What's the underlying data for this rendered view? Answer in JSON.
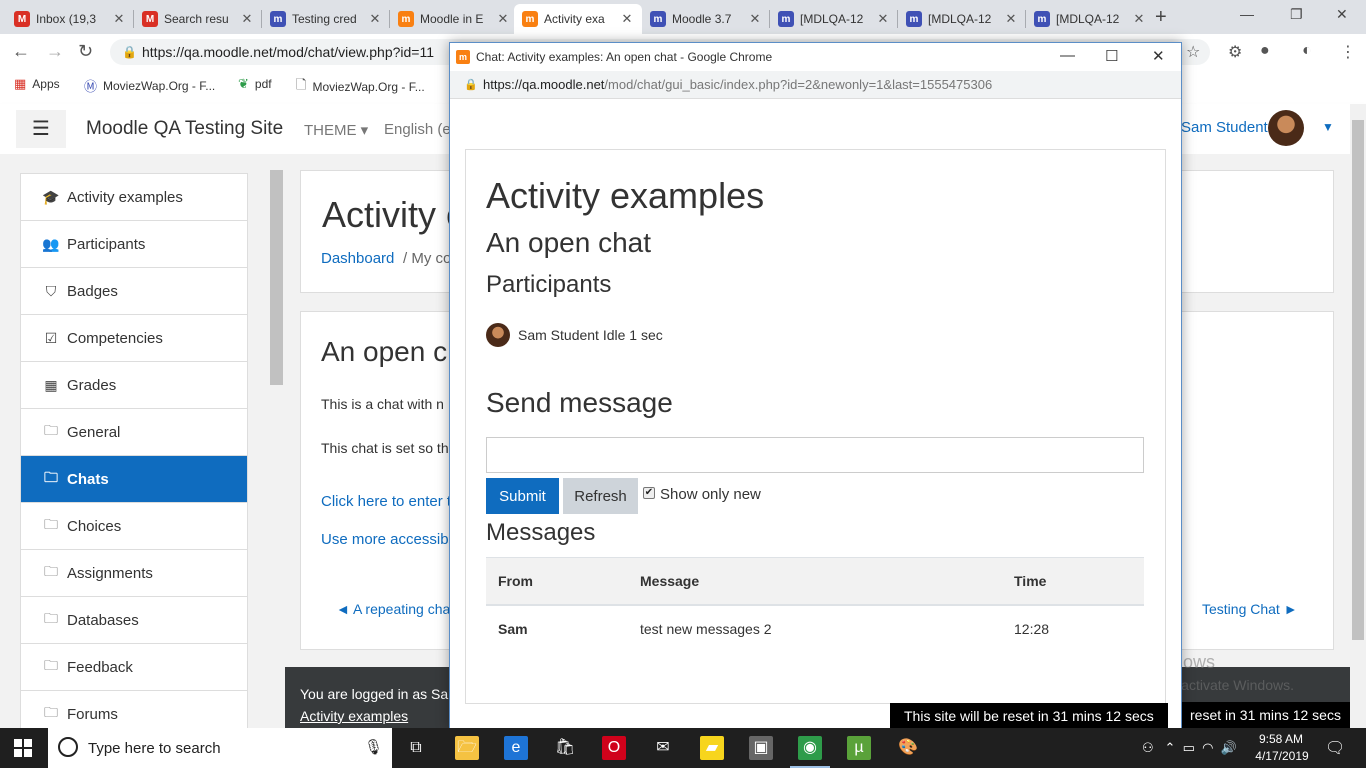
{
  "browser": {
    "tabs": [
      {
        "title": "Inbox (19,3",
        "icon": "gmail-icon",
        "color": "#d93025",
        "glyph": "M"
      },
      {
        "title": "Search resu",
        "icon": "gmail-icon",
        "color": "#d93025",
        "glyph": "M"
      },
      {
        "title": "Testing cred",
        "icon": "moodle-tracker-icon",
        "color": "#3f51b5",
        "glyph": "m"
      },
      {
        "title": "Moodle in E",
        "icon": "moodle-icon",
        "color": "#f98012",
        "glyph": "m"
      },
      {
        "title": "Activity exa",
        "icon": "moodle-icon",
        "color": "#f98012",
        "glyph": "m",
        "active": true
      },
      {
        "title": "Moodle 3.7",
        "icon": "moodle-tracker-icon",
        "color": "#3f51b5",
        "glyph": "m"
      },
      {
        "title": "[MDLQA-12",
        "icon": "moodle-tracker-icon",
        "color": "#3f51b5",
        "glyph": "m"
      },
      {
        "title": "[MDLQA-12",
        "icon": "moodle-tracker-icon",
        "color": "#3f51b5",
        "glyph": "m"
      },
      {
        "title": "[MDLQA-12",
        "icon": "moodle-tracker-icon",
        "color": "#3f51b5",
        "glyph": "m"
      }
    ],
    "url": "https://qa.moodle.net/mod/chat/view.php?id=11",
    "bookmarks": [
      {
        "label": "Apps",
        "icon": "apps-grid-icon"
      },
      {
        "label": "MoviezWap.Org - F...",
        "icon": "moviezwap-icon"
      },
      {
        "label": "pdf",
        "icon": "pdf-icon"
      },
      {
        "label": "MoviezWap.Org - F...",
        "icon": "page-icon"
      }
    ]
  },
  "moodle": {
    "site_name": "Moodle QA Testing Site",
    "theme_menu": "THEME",
    "language_menu": "English (e",
    "user_name": "Sam Student",
    "drawer": [
      {
        "label": "Activity examples",
        "icon": "graduation-cap-icon",
        "glyph": "🎓"
      },
      {
        "label": "Participants",
        "icon": "users-icon",
        "glyph": "👥"
      },
      {
        "label": "Badges",
        "icon": "shield-icon",
        "glyph": "⛉"
      },
      {
        "label": "Competencies",
        "icon": "check-square-icon",
        "glyph": "☑"
      },
      {
        "label": "Grades",
        "icon": "table-icon",
        "glyph": "▦"
      },
      {
        "label": "General",
        "icon": "folder-icon",
        "glyph": "🗀"
      },
      {
        "label": "Chats",
        "icon": "folder-icon",
        "glyph": "🗀",
        "active": true
      },
      {
        "label": "Choices",
        "icon": "folder-icon",
        "glyph": "🗀"
      },
      {
        "label": "Assignments",
        "icon": "folder-icon",
        "glyph": "🗀"
      },
      {
        "label": "Databases",
        "icon": "folder-icon",
        "glyph": "🗀"
      },
      {
        "label": "Feedback",
        "icon": "folder-icon",
        "glyph": "🗀"
      },
      {
        "label": "Forums",
        "icon": "folder-icon",
        "glyph": "🗀"
      }
    ],
    "page_heading": "Activity e",
    "breadcrumb_dashboard": "Dashboard",
    "breadcrumb_next": "/   My co",
    "chat_heading": "An open c",
    "intro_line1": "This is a chat with n",
    "intro_line2": "This chat is set so th",
    "enter_link": "Click here to enter t",
    "accessible_link": "Use more accessible",
    "prev_activity": "◄ A repeating cha",
    "next_activity": "Testing Chat ►",
    "logged_in_text": "You are logged in as Sa",
    "footer_link": "Activity examples",
    "reset_notice_main": "reset in 31 mins 12 secs"
  },
  "windows_watermark": {
    "line1": "Activate Windows",
    "line2": "Go to Settings to activate Windows."
  },
  "popup": {
    "window_title": "Chat: Activity examples: An open chat - Google Chrome",
    "url_host": "https://qa.moodle.net",
    "url_path": "/mod/chat/gui_basic/index.php?id=2&newonly=1&last=1555475306",
    "course_heading": "Activity examples",
    "chat_heading": "An open chat",
    "participants_heading": "Participants",
    "participant_text": "Sam Student Idle 1 sec",
    "send_heading": "Send message",
    "message_input_value": "",
    "submit_label": "Submit",
    "refresh_label": "Refresh",
    "show_only_new_label": "Show only new",
    "show_only_new_checked": true,
    "messages_heading": "Messages",
    "table": {
      "headers": [
        "From",
        "Message",
        "Time"
      ],
      "rows": [
        [
          "Sam",
          "test new messages 2",
          "12:28"
        ]
      ]
    },
    "reset_notice": "This site will be reset in 31 mins 12 secs"
  },
  "taskbar": {
    "search_placeholder": "Type here to search",
    "time": "9:58 AM",
    "date": "4/17/2019",
    "apps": [
      {
        "icon": "task-view-icon",
        "glyph": "⧉",
        "color": "transparent"
      },
      {
        "icon": "file-explorer-icon",
        "glyph": "🗁",
        "color": "#f5c242"
      },
      {
        "icon": "edge-icon",
        "glyph": "e",
        "color": "#1e74d6"
      },
      {
        "icon": "store-icon",
        "glyph": "🛍",
        "color": "transparent"
      },
      {
        "icon": "opera-icon",
        "glyph": "O",
        "color": "#d0021b"
      },
      {
        "icon": "mail-icon",
        "glyph": "✉",
        "color": "transparent"
      },
      {
        "icon": "sticky-notes-icon",
        "glyph": "▰",
        "color": "#f7d51d"
      },
      {
        "icon": "media-app-icon",
        "glyph": "▣",
        "color": "#666666"
      },
      {
        "icon": "chrome-icon",
        "glyph": "◉",
        "color": "#2e9c4a",
        "active": true
      },
      {
        "icon": "utorrent-icon",
        "glyph": "µ",
        "color": "#5aa23a"
      },
      {
        "icon": "paint-icon",
        "glyph": "🎨",
        "color": "transparent"
      }
    ]
  },
  "colors": {
    "moodle_blue": "#0f6cbf",
    "moodle_orange": "#f98012",
    "footer_dark": "#373a3c"
  }
}
